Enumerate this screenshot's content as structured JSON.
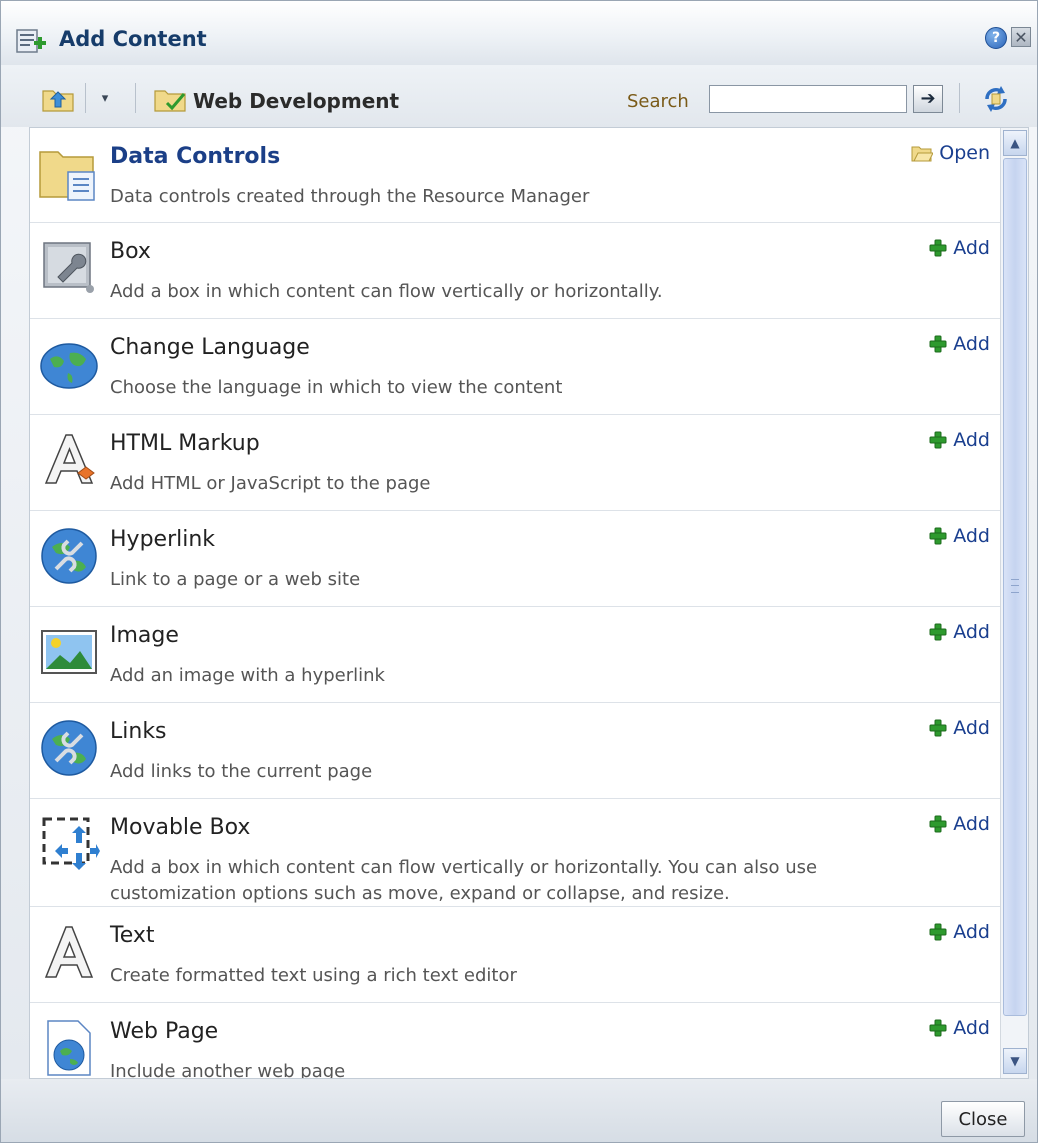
{
  "dialog": {
    "title": "Add Content",
    "help_icon": "help-icon",
    "help_glyph": "?",
    "close_icon": "close-icon",
    "close_glyph": "✕"
  },
  "toolbar": {
    "dropdown_glyph": "▾",
    "breadcrumb": "Web Development",
    "search_label": "Search",
    "search_value": "",
    "search_placeholder": "",
    "go_glyph": "➔"
  },
  "items": [
    {
      "title": "Data Controls",
      "description": "Data controls created through the Resource Manager",
      "action": "Open",
      "icon": "data-controls-folder-icon",
      "bold": true
    },
    {
      "title": "Box",
      "description": "Add a box in which content can flow vertically or horizontally.",
      "action": "Add",
      "icon": "box-wrench-icon"
    },
    {
      "title": "Change Language",
      "description": "Choose the language in which to view the content",
      "action": "Add",
      "icon": "globe-icon"
    },
    {
      "title": "HTML Markup",
      "description": "Add HTML or JavaScript to the page",
      "action": "Add",
      "icon": "html-markup-icon"
    },
    {
      "title": "Hyperlink",
      "description": "Link to a page or a web site",
      "action": "Add",
      "icon": "hyperlink-globe-icon"
    },
    {
      "title": "Image",
      "description": "Add an image with a hyperlink",
      "action": "Add",
      "icon": "image-icon"
    },
    {
      "title": "Links",
      "description": "Add links to the current page",
      "action": "Add",
      "icon": "links-globe-icon"
    },
    {
      "title": "Movable Box",
      "description": "Add a box in which content can flow vertically or horizontally. You can also use customization options such as move, expand or collapse, and resize.",
      "action": "Add",
      "icon": "movable-box-icon"
    },
    {
      "title": "Text",
      "description": "Create formatted text using a rich text editor",
      "action": "Add",
      "icon": "text-icon"
    },
    {
      "title": "Web Page",
      "description": "Include another web page",
      "action": "Add",
      "icon": "web-page-icon"
    }
  ],
  "scrollbar": {
    "up_glyph": "▲",
    "down_glyph": "▼"
  },
  "footer": {
    "close_label": "Close"
  },
  "colors": {
    "title": "#163c6a",
    "link": "#1a3f8f",
    "add_green": "#2e9a2e"
  }
}
